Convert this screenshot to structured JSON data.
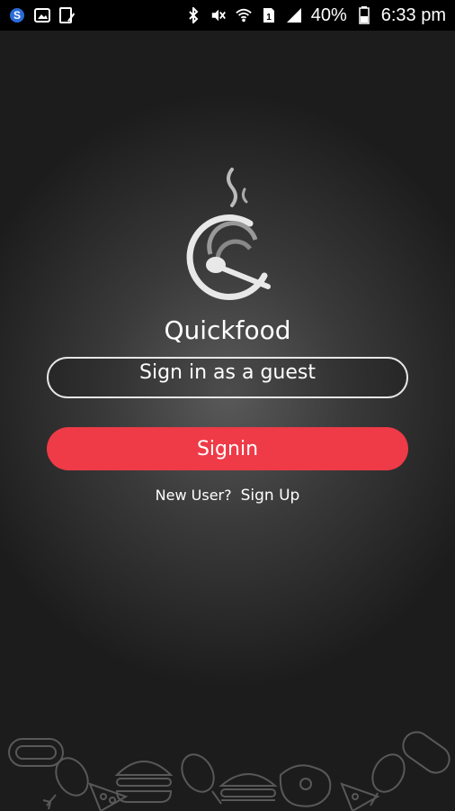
{
  "status_bar": {
    "left_icons": [
      "sync-s-icon",
      "gallery-icon",
      "edit-icon"
    ],
    "right_icons": [
      "bluetooth-icon",
      "mute-icon",
      "wifi-icon",
      "sim-1-icon",
      "signal-icon",
      "battery-icon"
    ],
    "battery": "40%",
    "time": "6:33 pm"
  },
  "app": {
    "name": "Quickfood",
    "logo_icon": "steaming-bowl-spoon-icon"
  },
  "login": {
    "guest_label": "Sign in as a guest",
    "signin_label": "Signin",
    "new_user_text": "New User?",
    "signup_label": "Sign Up"
  },
  "colors": {
    "accent": "#ef3a47",
    "background_center": "#5a5a5a",
    "background_edge": "#1c1c1c"
  },
  "decor": {
    "footer_icons": [
      "chicken-leg-icon",
      "pizza-slice-icon",
      "burger-icon",
      "hotdog-icon",
      "steak-icon"
    ]
  }
}
